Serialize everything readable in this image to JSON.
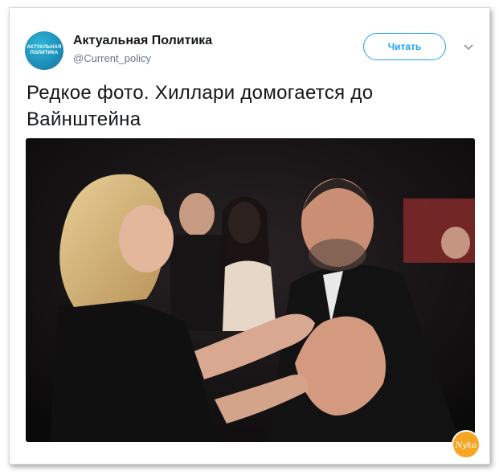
{
  "account": {
    "avatar_text_line1": "АКТУАЛЬНАЯ",
    "avatar_text_line2": "ПОЛИТИКА",
    "name": "Актуальная Политика",
    "handle": "@Current_policy"
  },
  "actions": {
    "follow_label": "Читать"
  },
  "tweet": {
    "text": "Редкое фото. Хиллари домогается до Вайнштейна"
  },
  "colors": {
    "accent": "#1da1f2",
    "avatar": "#1d8fb8",
    "handle": "#657786",
    "text": "#14171a",
    "watermark": "#f5a623"
  },
  "icons": {
    "more": "chevron-down-icon",
    "watermark": "logo-watermark"
  },
  "watermark": {
    "text": "Nyka"
  }
}
